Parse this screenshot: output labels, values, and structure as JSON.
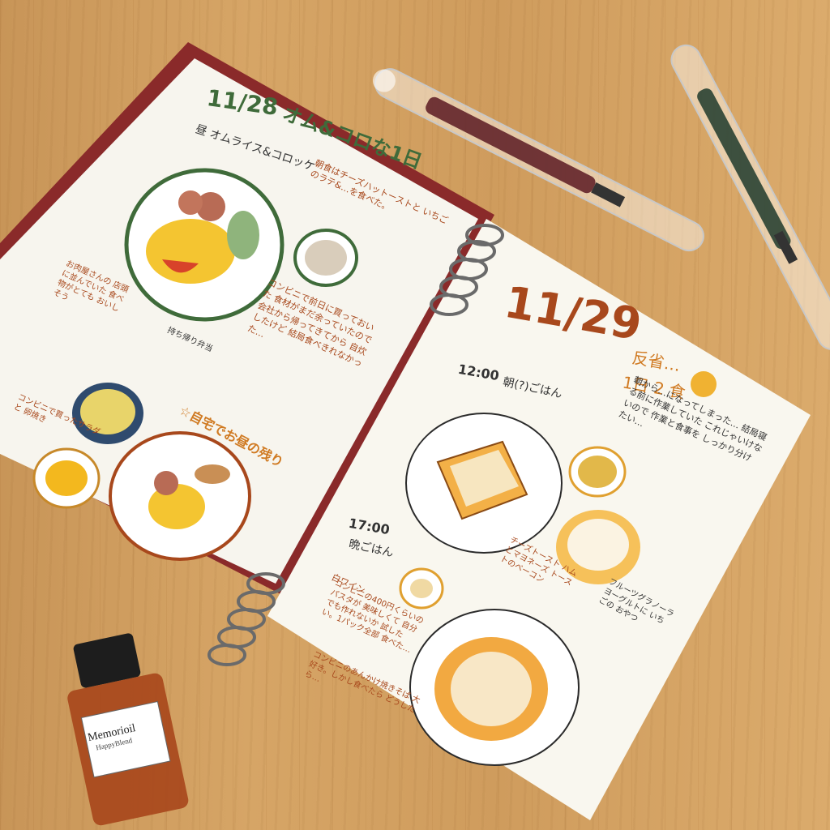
{
  "left_page": {
    "date": "11/28",
    "title": "オム&コロな1日",
    "lunch_label": "昼 オムライス&コロッケ",
    "breakfast_note": "朝食はチーズハットーストと いちごのラテ&…を食べた。",
    "middle_note": "コンビニで前日に買っておいた 食材がまだ余っていたので 会社から帰ってきてから 自炊したけど 結局食べきれなかった…",
    "side_note": "お肉屋さんの 店頭に並んでいた 食べ物がとても おいしそう",
    "bento_note": "持ち帰り弁当",
    "left_bottom_note": "コンビニで買ったサラダと 卵焼き",
    "heading_bottom": "☆自宅でお昼の残り"
  },
  "right_page": {
    "date": "11/29",
    "reflection": "反省…",
    "count": "1日 2 食",
    "reflection_note": "朝から…になってしまった… 結局寝る前に作業していた これじゃいけないので 作業と食事を しっかり分けたい…",
    "time1": "12:00",
    "meal1": "朝(?)ごはん",
    "time2": "17:00",
    "meal2": "晩ごはん",
    "toast_note": "チーズトースト ハムとマヨネーズ トーストのベーコン",
    "yogurt_note": "フルーツグラノーラ ヨーグルトに いちごの おやつ",
    "wine_note": "白ワイン",
    "dinner_note": "コンビニの400円くらいの パスタが 美味しくて 自分でも作れないか 試したい。1パック全部 食べた…",
    "dinner_note2": "コンビニのあんかけ焼きそば 大好き。しかし食べたら どうしたら…"
  },
  "ink_bottle": {
    "brand": "Memorioil",
    "name": "HappyBlend",
    "color": "#a8481c"
  },
  "pens": [
    {
      "name": "pen-dark-red",
      "color": "#5b1a22"
    },
    {
      "name": "pen-dark-green",
      "color": "#1f3a2c"
    }
  ]
}
